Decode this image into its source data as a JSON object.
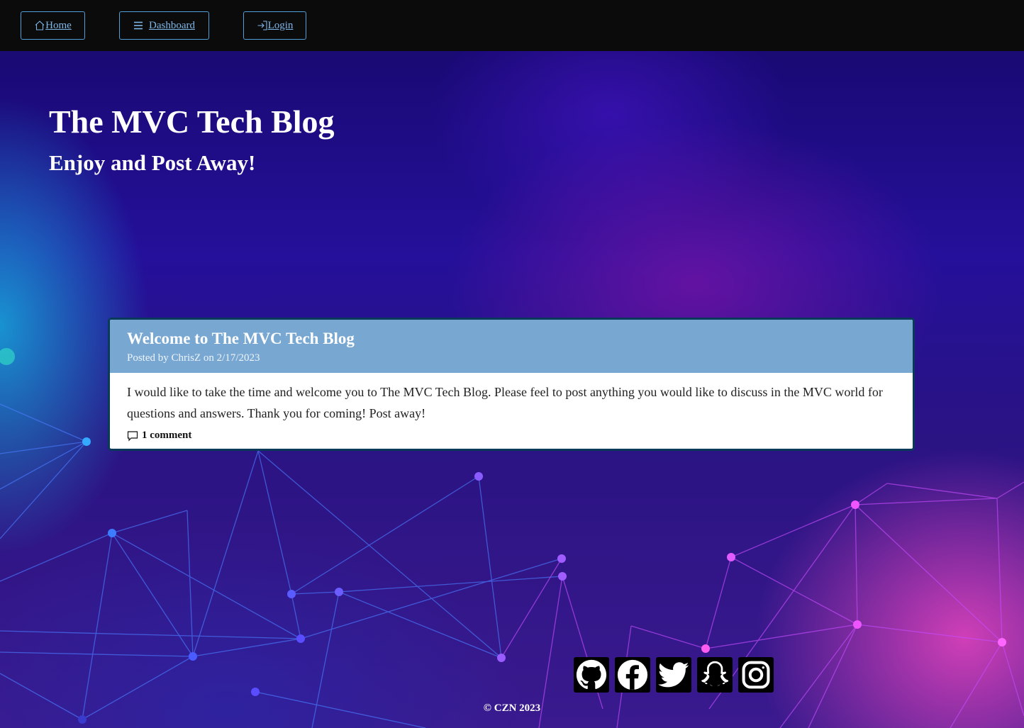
{
  "nav": {
    "home_label": "Home",
    "dashboard_label": "Dashboard",
    "login_label": "Login"
  },
  "header": {
    "title": "The MVC Tech Blog",
    "subtitle": "Enjoy and Post Away!"
  },
  "post": {
    "title": "Welcome to The MVC Tech Blog",
    "meta": "Posted by ChrisZ on 2/17/2023",
    "content": "I would like to take the time and welcome you to The MVC Tech Blog. Please feel to post anything you would like to discuss in the MVC world for questions and answers. Thank you for coming! Post away!",
    "comments": "1 comment"
  },
  "footer": {
    "socials": [
      "github-icon",
      "facebook-icon",
      "twitter-icon",
      "snapchat-icon",
      "instagram-icon"
    ],
    "copyright": "© CZN 2023"
  },
  "colors": {
    "nav_bg": "#0b0b0b",
    "nav_accent": "#4f9fd8",
    "card_header": "#78a8d2",
    "card_border": "#0a3a5a"
  }
}
